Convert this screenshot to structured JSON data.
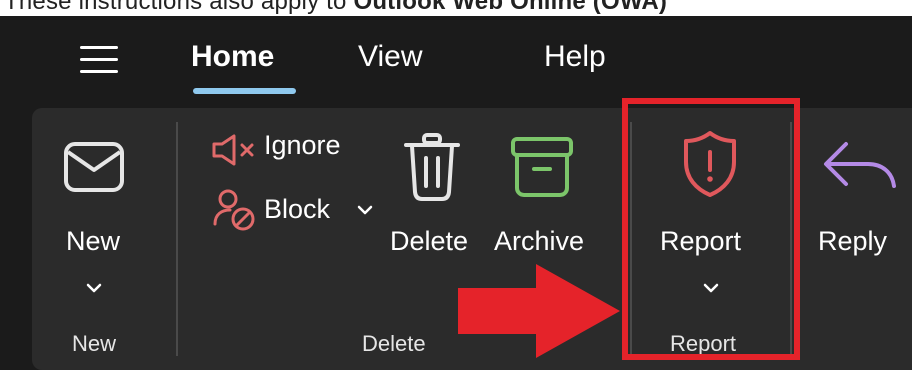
{
  "caption": {
    "text_before": "These instructions also apply to ",
    "text_bold": "Outlook Web Online (OWA)"
  },
  "nav": {
    "menu_icon": "hamburger-menu-icon",
    "tabs": [
      {
        "label": "Home",
        "selected": true
      },
      {
        "label": "View",
        "selected": false
      },
      {
        "label": "Help",
        "selected": false
      }
    ],
    "underline_color": "#8fc9ee"
  },
  "ribbon": {
    "new": {
      "label": "New",
      "icon": "mail-envelope-icon",
      "group_label": "New"
    },
    "delete_group": {
      "group_label": "Delete",
      "ignore": {
        "label": "Ignore",
        "icon": "speaker-mute-icon"
      },
      "block": {
        "label": "Block",
        "icon": "block-sender-icon"
      },
      "delete": {
        "label": "Delete",
        "icon": "trash-icon"
      },
      "archive": {
        "label": "Archive",
        "icon": "archive-box-icon"
      }
    },
    "report": {
      "label": "Report",
      "icon": "shield-alert-icon",
      "group_label": "Report"
    },
    "reply": {
      "label": "Reply",
      "icon": "reply-arrow-icon"
    }
  },
  "colors": {
    "highlight": "#e5232a",
    "ignore_icon": "#e06a6a",
    "archive_icon": "#7cc56a",
    "report_icon": "#e0585c",
    "reply_icon": "#b48ae6"
  }
}
